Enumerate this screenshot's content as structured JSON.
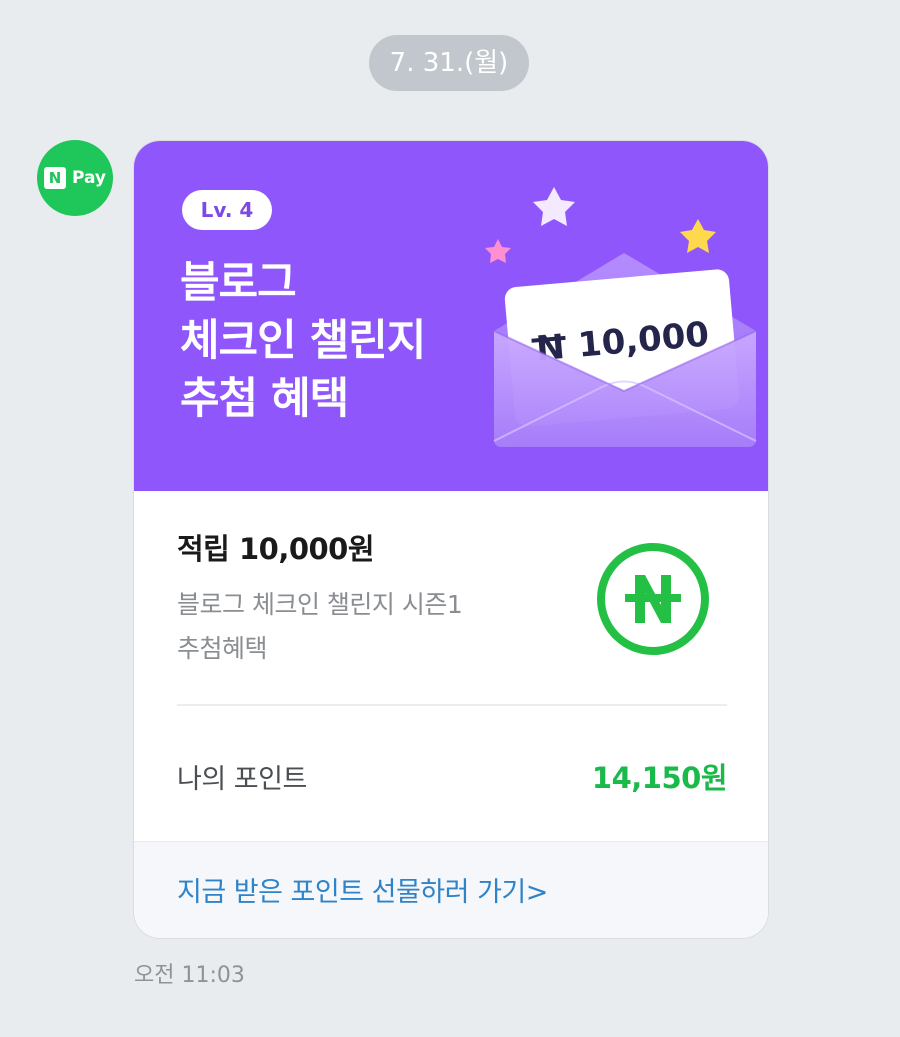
{
  "chat": {
    "date_separator": "7. 31.(월)",
    "sender_avatar": {
      "icon": "naver-pay-logo-icon",
      "n_letter": "N",
      "pay_text": "Pay",
      "color": "#1fc65a"
    },
    "message_time": "오전 11:03"
  },
  "card": {
    "banner": {
      "background_color": "#8f57fb",
      "level_badge": "Lv. 4",
      "title_lines": [
        "블로그",
        "체크인 챌린지",
        "추첨 혜택"
      ],
      "envelope_amount": "10,000"
    },
    "reward": {
      "title": "적립 10,000원",
      "description_line1": "블로그 체크인 챌린지 시즌1",
      "description_line2": "추첨혜택",
      "icon": "naver-pay-point-icon"
    },
    "points": {
      "label": "나의 포인트",
      "value": "14,150원",
      "value_color": "#19b94a"
    },
    "link": {
      "label": "지금 받은 포인트 선물하러 가기>",
      "color": "#2f83c8"
    }
  }
}
